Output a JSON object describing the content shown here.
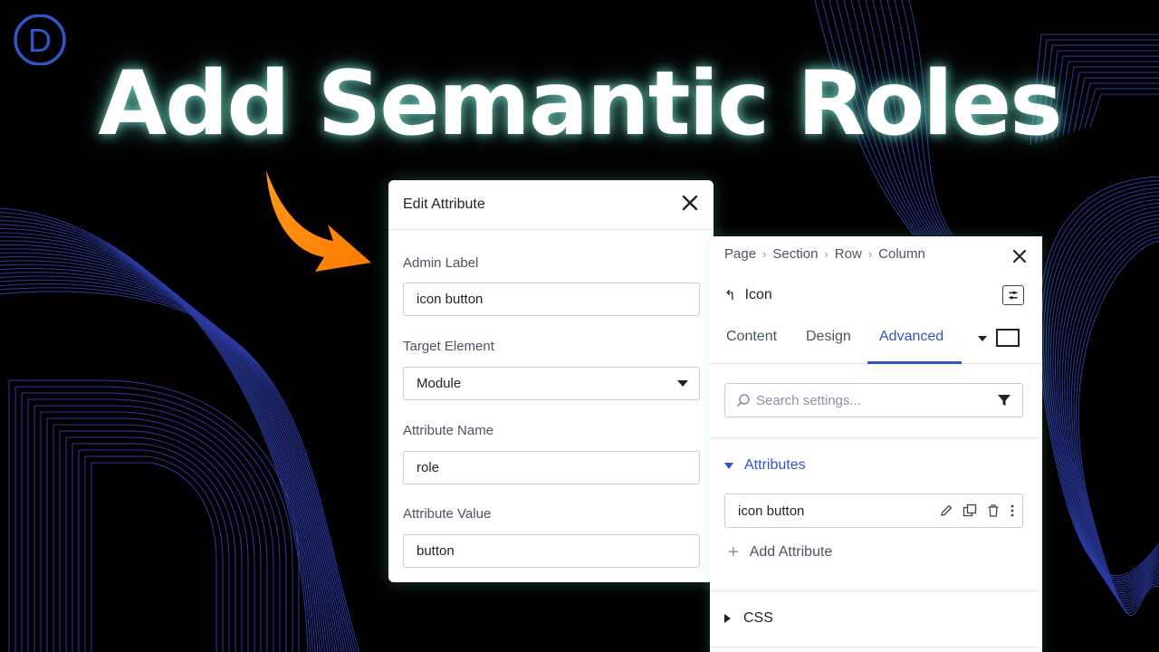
{
  "headline": "Add Semantic Roles",
  "logo": {
    "letter": "D",
    "color": "#2f56c8"
  },
  "colors": {
    "accent": "#2f56c8",
    "arrow": "#ff8a00",
    "line_art": "#3b4fd8"
  },
  "modal": {
    "title": "Edit Attribute",
    "fields": {
      "admin_label": {
        "label": "Admin Label",
        "value": "icon button"
      },
      "target_element": {
        "label": "Target Element",
        "value": "Module"
      },
      "attribute_name": {
        "label": "Attribute Name",
        "value": "role"
      },
      "attribute_value": {
        "label": "Attribute Value",
        "value": "button"
      }
    }
  },
  "panel": {
    "breadcrumb": [
      "Page",
      "Section",
      "Row",
      "Column"
    ],
    "module_name": "Icon",
    "tabs": [
      {
        "label": "Content",
        "active": false
      },
      {
        "label": "Design",
        "active": false
      },
      {
        "label": "Advanced",
        "active": true
      }
    ],
    "search_placeholder": "Search settings...",
    "attributes_section": {
      "title": "Attributes",
      "expanded": true,
      "items": [
        {
          "label": "icon button"
        }
      ],
      "add_label": "Add Attribute"
    },
    "css_section": {
      "title": "CSS",
      "expanded": false
    }
  }
}
